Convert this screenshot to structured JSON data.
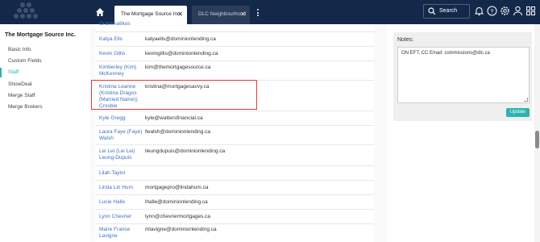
{
  "topbar": {
    "logo_icon": "dots-logo-icon",
    "home_icon": "home-icon",
    "tabs": [
      {
        "label": "The Mortgage Source Inc.",
        "active": true
      },
      {
        "label": "DLC Neighbourhood",
        "active": false
      }
    ],
    "close_glyph": "✕",
    "search_label": "Search",
    "icons": [
      "bell-icon",
      "help-icon",
      "gear-icon",
      "user-icon",
      "apps-icon"
    ]
  },
  "sidebar": {
    "company_name": "The Mortgage Source Inc.",
    "items": [
      {
        "label": "Basic Info",
        "active": false
      },
      {
        "label": "Custom Fields",
        "active": false
      },
      {
        "label": "Staff",
        "active": true
      },
      {
        "label": "ShowDeal",
        "active": false
      },
      {
        "label": "Merge Staff",
        "active": false
      },
      {
        "label": "Merge Brokers",
        "active": false
      }
    ]
  },
  "staff": [
    {
      "name": "Grammatikos",
      "email": ""
    },
    {
      "name": "Katya Ells",
      "email": "katyaells@dominionlending.ca"
    },
    {
      "name": "Kevin Gillis",
      "email": "kevingillis@dominionlending.ca"
    },
    {
      "name": "Kimberley (Kim) McKenney",
      "email": "kim@themortgagesource.ca"
    },
    {
      "name": "Kristina Leanne (Kristina Dragos (Married Name)) Crosbie",
      "email": "kristina@mortgagesavvy.ca"
    },
    {
      "name": "Kyle Gregg",
      "email": "kyle@wattersfinancial.ca"
    },
    {
      "name": "Laura Faye (Faye) Walsh",
      "email": "fwalsh@dominionlending.ca"
    },
    {
      "name": "Lei Lei (Lei Lei) Leung-Dupuis",
      "email": "lleungdupuis@dominionlending.ca"
    },
    {
      "name": "Lilah Taylor",
      "email": ""
    },
    {
      "name": "Linda Lin Hum",
      "email": "mortgagepro@lindahum.ca"
    },
    {
      "name": "Lucie Halle",
      "email": "lhalle@dominionlending.ca"
    },
    {
      "name": "Lynn Chevrier",
      "email": "lynn@chevriermortgages.ca"
    },
    {
      "name": "Maire France Lavigne",
      "email": "mlavigne@dominionlending.ca"
    }
  ],
  "notes": {
    "title": "Notes:",
    "text": "ON EFT, CC Email: commissions@dlc.ca",
    "update_label": "Update"
  },
  "colors": {
    "topbar": "#14294a",
    "accent": "#2bb3b1",
    "link": "#3d72c4",
    "highlight": "#e53935"
  }
}
